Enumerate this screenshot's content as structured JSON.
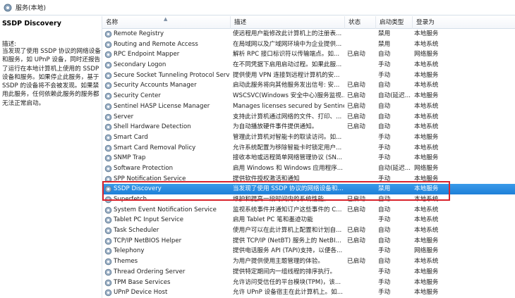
{
  "window": {
    "title": "服务(本地)",
    "icon": "gear-icon"
  },
  "detail": {
    "service_name": "SSDP Discovery",
    "description_label": "描述:",
    "description": "当发现了使用 SSDP 协议的网络设备和服务，如 UPnP 设备，同时还报告了运行在本地计算机上使用的 SSDP 设备和服务。如果停止此服务，基于 SSDP 的设备将不会被发现。如果禁用此服务，任何依赖此服务的服务都无法正常启动。"
  },
  "columns": {
    "name": "名称",
    "description": "描述",
    "status": "状态",
    "startup": "启动类型",
    "logon": "登录为"
  },
  "sort_indicator": "▲",
  "services": [
    {
      "name": "Remote Registry",
      "desc": "使远程用户能修改此计算机上的注册表...",
      "status": "",
      "startup": "禁用",
      "logon": "本地服务"
    },
    {
      "name": "Routing and Remote Access",
      "desc": "在局域网以及广域网环境中为企业提供...",
      "status": "",
      "startup": "禁用",
      "logon": "本地系统"
    },
    {
      "name": "RPC Endpoint Mapper",
      "desc": "解析 RPC 接口标识符以传输端点。如...",
      "status": "已启动",
      "startup": "自动",
      "logon": "网络服务"
    },
    {
      "name": "Secondary Logon",
      "desc": "在不同凭据下启用启动过程。如果此服...",
      "status": "",
      "startup": "手动",
      "logon": "本地系统"
    },
    {
      "name": "Secure Socket Tunneling Protocol Service",
      "desc": "提供使用 VPN 连接到远程计算机的安...",
      "status": "",
      "startup": "手动",
      "logon": "本地服务"
    },
    {
      "name": "Security Accounts Manager",
      "desc": "启动此服务将向其他服务发出信号: 安...",
      "status": "已启动",
      "startup": "自动",
      "logon": "本地系统"
    },
    {
      "name": "Security Center",
      "desc": "WSCSVC(Windows 安全中心)服务监视...",
      "status": "已启动",
      "startup": "自动(延迟...",
      "logon": "本地服务"
    },
    {
      "name": "Sentinel HASP License Manager",
      "desc": "Manages licenses secured by Sentinel...",
      "status": "已启动",
      "startup": "自动",
      "logon": "本地系统"
    },
    {
      "name": "Server",
      "desc": "支持此计算机通过网络的文件、打印、...",
      "status": "已启动",
      "startup": "自动",
      "logon": "本地系统"
    },
    {
      "name": "Shell Hardware Detection",
      "desc": "为自动播放硬件事件提供通知。",
      "status": "已启动",
      "startup": "自动",
      "logon": "本地系统"
    },
    {
      "name": "Smart Card",
      "desc": "管理此计算机对智能卡的取读访问。如...",
      "status": "",
      "startup": "手动",
      "logon": "本地服务"
    },
    {
      "name": "Smart Card Removal Policy",
      "desc": "允许系统配置为移除智能卡时锁定用户...",
      "status": "",
      "startup": "手动",
      "logon": "本地系统"
    },
    {
      "name": "SNMP Trap",
      "desc": "接收本地或远程简单网络管理协议 (SN...",
      "status": "",
      "startup": "手动",
      "logon": "本地服务"
    },
    {
      "name": "Software Protection",
      "desc": "启用 Windows 和 Windows 应用程序...",
      "status": "",
      "startup": "自动(延迟...",
      "logon": "网络服务"
    },
    {
      "name": "SPP Notification Service",
      "desc": "提供软件授权激活和通知",
      "status": "",
      "startup": "手动",
      "logon": "本地服务"
    },
    {
      "name": "SSDP Discovery",
      "desc": "当发现了使用 SSDP 协议的网络设备和...",
      "status": "",
      "startup": "禁用",
      "logon": "本地服务",
      "selected": true
    },
    {
      "name": "Superfetch",
      "desc": "维护和提高一段时间内的系统性能。",
      "status": "已启动",
      "startup": "自动",
      "logon": "本地系统"
    },
    {
      "name": "System Event Notification Service",
      "desc": "监视系统事件并通知订户这些事件的 C...",
      "status": "已启动",
      "startup": "自动",
      "logon": "本地系统"
    },
    {
      "name": "Tablet PC Input Service",
      "desc": "启用 Tablet PC 笔和墨迹功能",
      "status": "",
      "startup": "手动",
      "logon": "本地系统"
    },
    {
      "name": "Task Scheduler",
      "desc": "使用户可以在此计算机上配置和计划自...",
      "status": "已启动",
      "startup": "自动",
      "logon": "本地系统"
    },
    {
      "name": "TCP/IP NetBIOS Helper",
      "desc": "提供 TCP/IP (NetBT) 服务上的 NetBI...",
      "status": "已启动",
      "startup": "自动",
      "logon": "本地服务"
    },
    {
      "name": "Telephony",
      "desc": "提供电话服务 API (TAPI)支持，以便各...",
      "status": "",
      "startup": "手动",
      "logon": "网络服务"
    },
    {
      "name": "Themes",
      "desc": "为用户提供使用主题管理的体验。",
      "status": "已启动",
      "startup": "自动",
      "logon": "本地系统"
    },
    {
      "name": "Thread Ordering Server",
      "desc": "提供特定期间内一组线程的排序执行。",
      "status": "",
      "startup": "手动",
      "logon": "本地服务"
    },
    {
      "name": "TPM Base Services",
      "desc": "允许访问受信任的平台模块(TPM)，该...",
      "status": "",
      "startup": "手动",
      "logon": "本地服务"
    },
    {
      "name": "UPnP Device Host",
      "desc": "允许 UPnP 设备宿主在此计算机上。如...",
      "status": "",
      "startup": "手动",
      "logon": "本地服务"
    }
  ],
  "colors": {
    "selection": "#1e7fd8",
    "highlight_box": "#d9232b"
  }
}
